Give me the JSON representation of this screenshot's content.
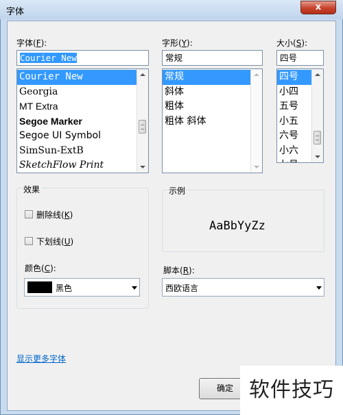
{
  "window": {
    "title": "字体",
    "close_glyph": "x"
  },
  "font": {
    "label": "字体(",
    "key": "F",
    "label_end": "):",
    "value": "Courier New",
    "items": [
      {
        "label": "Courier New",
        "selected": true
      },
      {
        "label": "Georgia"
      },
      {
        "label": "MT Extra"
      },
      {
        "label": "Segoe Marker"
      },
      {
        "label": "Segoe UI Symbol"
      },
      {
        "label": "SimSun-ExtB"
      },
      {
        "label": "SketchFlow Print"
      }
    ]
  },
  "style": {
    "label": "字形(",
    "key": "Y",
    "label_end": "):",
    "value": "常规",
    "items": [
      {
        "label": "常规",
        "selected": true
      },
      {
        "label": "斜体"
      },
      {
        "label": "粗体"
      },
      {
        "label": "粗体 斜体"
      }
    ]
  },
  "size": {
    "label": "大小(",
    "key": "S",
    "label_end": "):",
    "value": "四号",
    "items": [
      {
        "label": "四号",
        "selected": true
      },
      {
        "label": "小四"
      },
      {
        "label": "五号"
      },
      {
        "label": "小五"
      },
      {
        "label": "六号"
      },
      {
        "label": "小六"
      },
      {
        "label": "七号"
      }
    ]
  },
  "effects": {
    "title": "效果",
    "strikeout": {
      "label": "删除线(",
      "key": "K",
      "label_end": ")",
      "checked": false
    },
    "underline": {
      "label": "下划线(",
      "key": "U",
      "label_end": ")",
      "checked": false
    },
    "color_label": "颜色(",
    "color_key": "C",
    "color_label_end": "):",
    "color_value": "黑色",
    "color_swatch": "#000000"
  },
  "sample": {
    "title": "示例",
    "text": "AaBbYyZz"
  },
  "script": {
    "label": "脚本(",
    "key": "R",
    "label_end": "):",
    "value": "西欧语言"
  },
  "more_fonts": "显示更多字体",
  "ok_button": "确定",
  "watermark": "软件技巧"
}
